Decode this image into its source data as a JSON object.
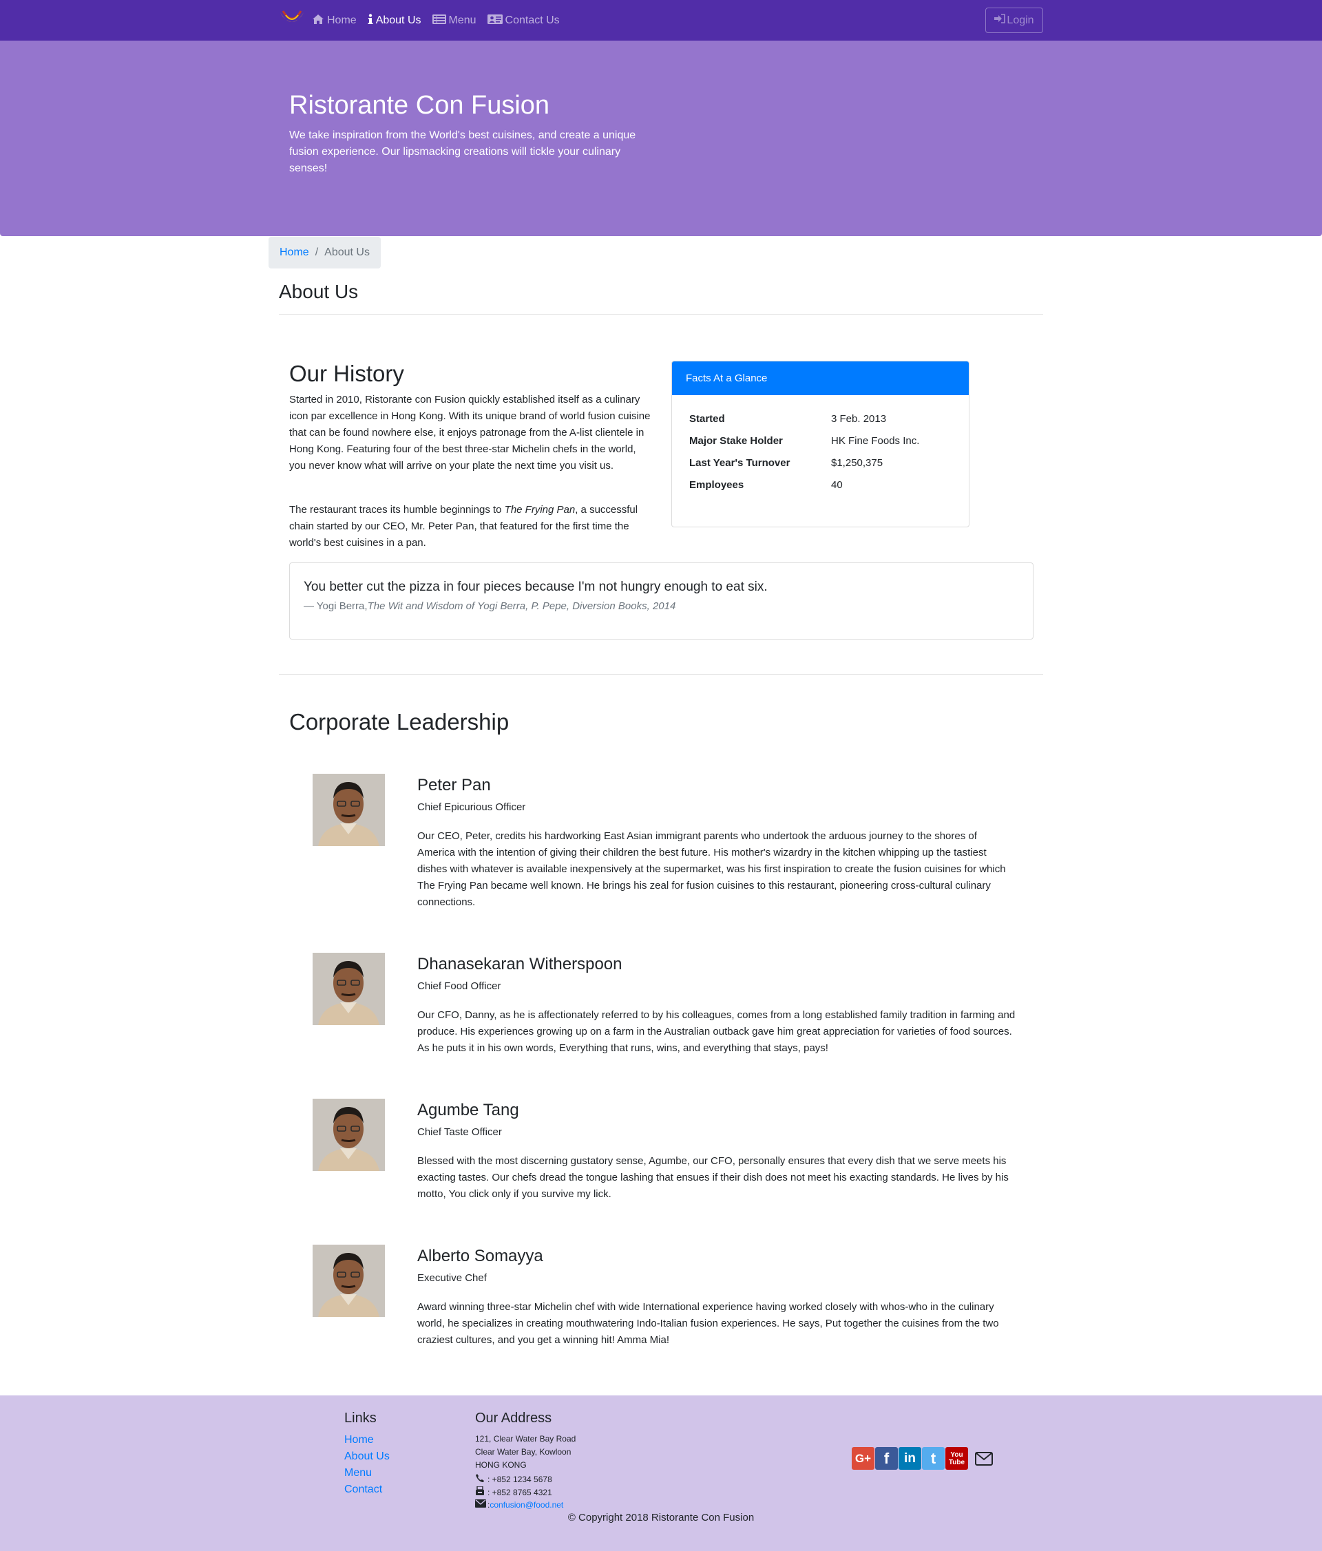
{
  "navbar": {
    "items": [
      {
        "label": "Home",
        "icon": "home-icon"
      },
      {
        "label": "About Us",
        "icon": "info-icon"
      },
      {
        "label": "Menu",
        "icon": "list-icon"
      },
      {
        "label": "Contact Us",
        "icon": "address-card-icon"
      }
    ],
    "active_index": 1,
    "login_label": "Login",
    "bg_color": "#512da8"
  },
  "jumbotron": {
    "title": "Ristorante Con Fusion",
    "text": "We take inspiration from the World's best cuisines, and create a unique fusion experience. Our lipsmacking creations will tickle your culinary senses!",
    "bg_color": "#9575cd"
  },
  "breadcrumb": {
    "home": "Home",
    "separator": "/",
    "current": "About Us"
  },
  "page_title": "About Us",
  "history": {
    "title": "Our History",
    "paragraph1": "Started in 2010, Ristorante con Fusion quickly established itself as a culinary icon par excellence in Hong Kong. With its unique brand of world fusion cuisine that can be found nowhere else, it enjoys patronage from the A-list clientele in Hong Kong. Featuring four of the best three-star Michelin chefs in the world, you never know what will arrive on your plate the next time you visit us.",
    "paragraph2_before": "The restaurant traces its humble beginnings to ",
    "paragraph2_em": "The Frying Pan",
    "paragraph2_after": ", a successful chain started by our CEO, Mr. Peter Pan, that featured for the first time the world's best cuisines in a pan."
  },
  "facts": {
    "header": "Facts At a Glance",
    "rows": [
      {
        "key": "Started",
        "value": "3 Feb. 2013"
      },
      {
        "key": "Major Stake Holder",
        "value": "HK Fine Foods Inc."
      },
      {
        "key": "Last Year's Turnover",
        "value": "$1,250,375"
      },
      {
        "key": "Employees",
        "value": "40"
      }
    ],
    "header_color": "#007bff"
  },
  "quote": {
    "text": "You better cut the pizza in four pieces because I'm not hungry enough to eat six.",
    "author": "— Yogi Berra,",
    "source": "The Wit and Wisdom of Yogi Berra, P. Pepe, Diversion Books, 2014"
  },
  "leadership": {
    "title": "Corporate Leadership",
    "leaders": [
      {
        "name": "Peter Pan",
        "designation": "Chief Epicurious Officer",
        "description": "Our CEO, Peter, credits his hardworking East Asian immigrant parents who undertook the arduous journey to the shores of America with the intention of giving their children the best future. His mother's wizardry in the kitchen whipping up the tastiest dishes with whatever is available inexpensively at the supermarket, was his first inspiration to create the fusion cuisines for which The Frying Pan became well known. He brings his zeal for fusion cuisines to this restaurant, pioneering cross-cultural culinary connections."
      },
      {
        "name": "Dhanasekaran Witherspoon",
        "designation": "Chief Food Officer",
        "description": "Our CFO, Danny, as he is affectionately referred to by his colleagues, comes from a long established family tradition in farming and produce. His experiences growing up on a farm in the Australian outback gave him great appreciation for varieties of food sources. As he puts it in his own words, Everything that runs, wins, and everything that stays, pays!"
      },
      {
        "name": "Agumbe Tang",
        "designation": "Chief Taste Officer",
        "description": "Blessed with the most discerning gustatory sense, Agumbe, our CFO, personally ensures that every dish that we serve meets his exacting tastes. Our chefs dread the tongue lashing that ensues if their dish does not meet his exacting standards. He lives by his motto, You click only if you survive my lick."
      },
      {
        "name": "Alberto Somayya",
        "designation": "Executive Chef",
        "description": "Award winning three-star Michelin chef with wide International experience having worked closely with whos-who in the culinary world, he specializes in creating mouthwatering Indo-Italian fusion experiences. He says, Put together the cuisines from the two craziest cultures, and you get a winning hit! Amma Mia!"
      }
    ]
  },
  "footer": {
    "links_title": "Links",
    "links": [
      "Home",
      "About Us",
      "Menu",
      "Contact"
    ],
    "address_title": "Our Address",
    "address_lines": [
      "121, Clear Water Bay Road",
      "Clear Water Bay, Kowloon",
      "HONG KONG"
    ],
    "phone": ": +852 1234 5678",
    "fax": ": +852 8765 4321",
    "email_prefix": ": ",
    "email": "confusion@food.net",
    "social": [
      {
        "label": "G+",
        "icon": "google-plus-icon",
        "color": "#dd4b39"
      },
      {
        "label": "f",
        "icon": "facebook-icon",
        "color": "#3b5998"
      },
      {
        "label": "in",
        "icon": "linkedin-icon",
        "color": "#007bb6"
      },
      {
        "label": "t",
        "icon": "twitter-icon",
        "color": "#55acee"
      },
      {
        "label": "You Tube",
        "icon": "youtube-icon",
        "color": "#bb0000"
      }
    ],
    "copyright": "© Copyright 2018 Ristorante Con Fusion",
    "bg_color": "#d1c4e9"
  }
}
